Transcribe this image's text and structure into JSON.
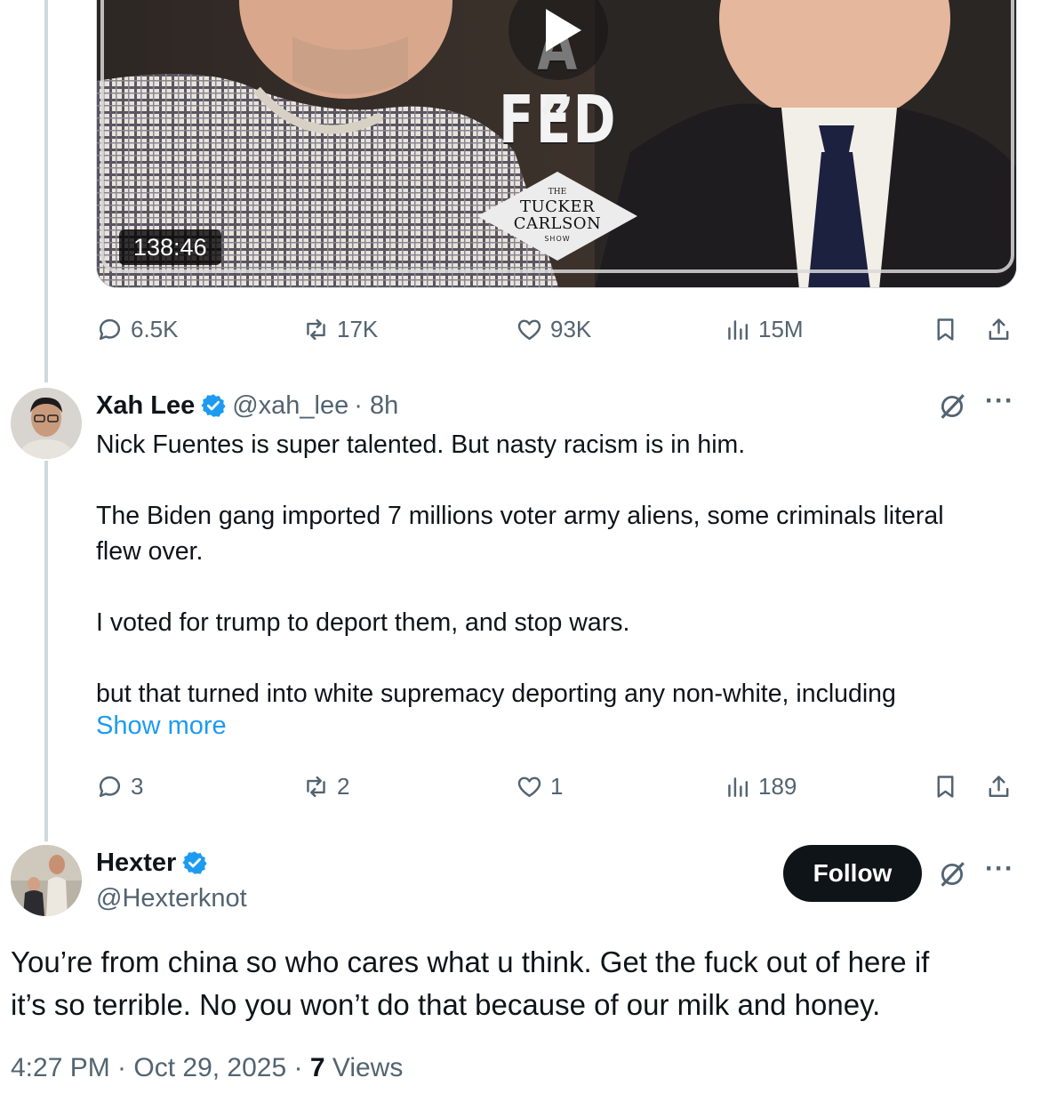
{
  "embedded_video": {
    "duration": "138:46",
    "overlay_title": "A FED",
    "overlay_quote": "”",
    "show_logo": {
      "line1": "THE",
      "line2": "TUCKER",
      "line3": "CARLSON",
      "line4": "SHOW"
    }
  },
  "quoted_post_actions": {
    "replies": "6.5K",
    "reposts": "17K",
    "likes": "93K",
    "views": "15M"
  },
  "reply_post": {
    "author_name": "Xah Lee",
    "handle": "@xah_lee",
    "time": "· 8h",
    "paragraphs": [
      "Nick Fuentes is super talented. But nasty racism is in him.",
      "The Biden gang imported 7 millions voter army aliens, some criminals literal",
      "flew over.",
      "I voted for trump to deport them, and stop wars.",
      "but that turned into white supremacy deporting any non-white, including"
    ],
    "show_more": "Show more",
    "actions": {
      "replies": "3",
      "reposts": "2",
      "likes": "1",
      "views": "189"
    }
  },
  "main_post": {
    "author_name": "Hexter",
    "handle": "@Hexterknot",
    "follow_label": "Follow",
    "text_lines": [
      "You’re from china so who cares what u think. Get the fuck out of here if",
      "it’s so terrible. No you won’t do that because of our milk and honey."
    ],
    "timestamp": "4:27 PM · Oct 29, 2025 · ",
    "views_count": "7",
    "views_label": " Views"
  },
  "icons": {
    "reply": "reply-icon",
    "repost": "repost-icon",
    "like": "heart-icon",
    "views": "views-chart-icon",
    "bookmark": "bookmark-icon",
    "share": "share-icon",
    "grok": "grok-icon",
    "more": "more-icon",
    "verified": "verified-badge-icon"
  },
  "colors": {
    "accent": "#1d9bf0",
    "secondary_text": "#536471",
    "primary_text": "#0f1419",
    "thread_line": "#cfd9de",
    "follow_button": "#0f1419"
  }
}
